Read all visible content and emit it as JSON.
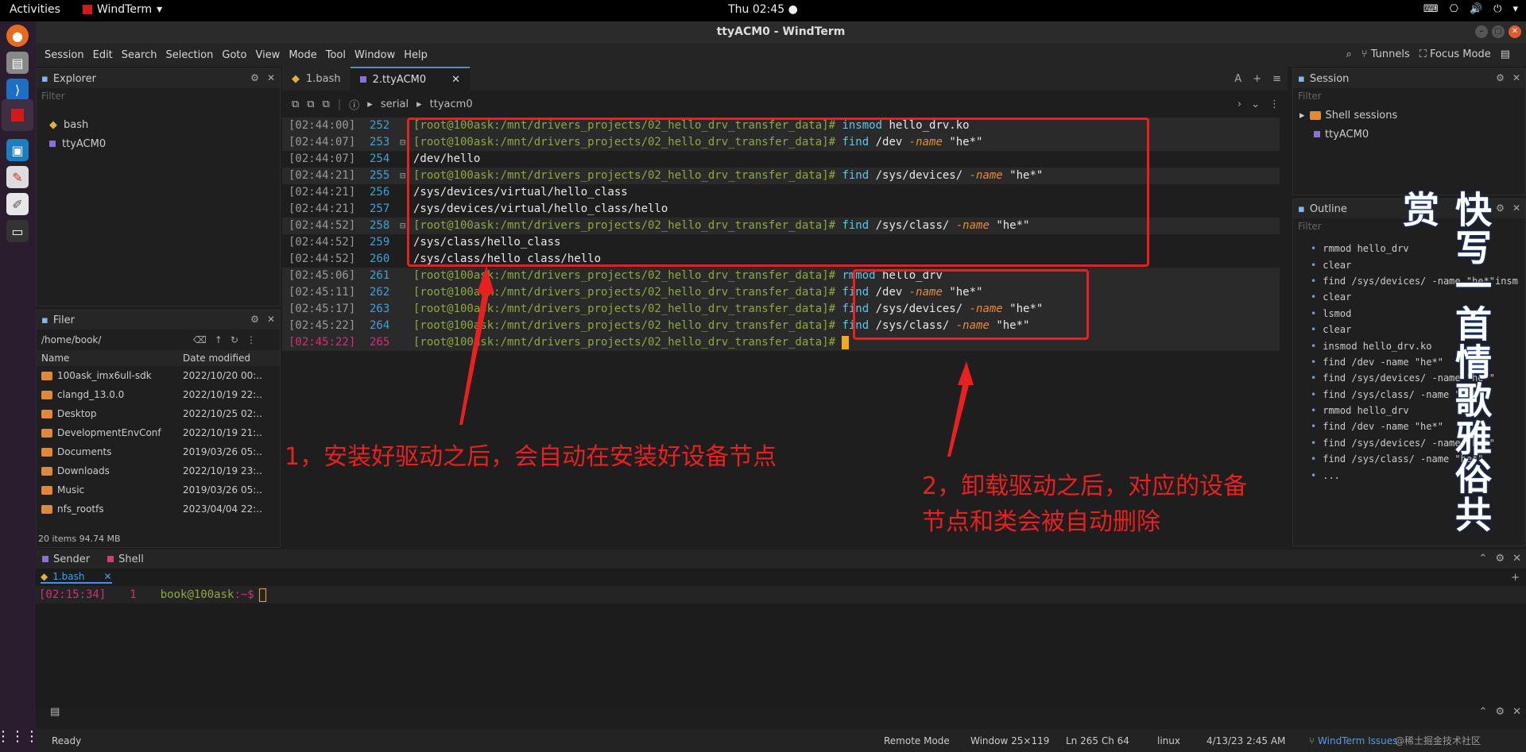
{
  "topbar": {
    "activities": "Activities",
    "app": "WindTerm",
    "clock": "Thu 02:45 ●"
  },
  "window": {
    "title": "ttyACM0 - WindTerm"
  },
  "menu": [
    "Session",
    "Edit",
    "Search",
    "Selection",
    "Goto",
    "View",
    "Mode",
    "Tool",
    "Window",
    "Help"
  ],
  "menu_right": {
    "tunnels": "Tunnels",
    "focus": "Focus Mode"
  },
  "explorer": {
    "title": "Explorer",
    "filter": "Filter",
    "items": [
      "bash",
      "ttyACM0"
    ]
  },
  "filer": {
    "title": "Filer",
    "path": "/home/book/",
    "col_name": "Name",
    "col_date": "Date modified",
    "rows": [
      [
        "100ask_imx6ull-sdk",
        "2022/10/20 00:.."
      ],
      [
        "clangd_13.0.0",
        "2022/10/19 22:.."
      ],
      [
        "Desktop",
        "2022/10/25 02:.."
      ],
      [
        "DevelopmentEnvConf",
        "2022/10/19 21:.."
      ],
      [
        "Documents",
        "2019/03/26 05:.."
      ],
      [
        "Downloads",
        "2022/10/19 23:.."
      ],
      [
        "Music",
        "2019/03/26 05:.."
      ],
      [
        "nfs_rootfs",
        "2023/04/04 22:.."
      ]
    ],
    "footer": "20 items 94.74 MB"
  },
  "tabs": [
    "1.bash",
    "2.ttyACM0"
  ],
  "crumb": [
    "serial",
    "ttyacm0"
  ],
  "prompt": "[root@100ask:/mnt/drivers_projects/02_hello_drv_transfer_data]# ",
  "lines": [
    {
      "ts": "[02:44:00]",
      "ln": "252",
      "cmd": "insmod",
      "rest": " hello_drv.ko"
    },
    {
      "ts": "[02:44:07]",
      "ln": "253",
      "cmd": "find",
      "rest": " /dev ",
      "opt": "-name",
      "str": " \"he*\""
    },
    {
      "ts": "[02:44:07]",
      "ln": "254",
      "out": "/dev/hello"
    },
    {
      "ts": "[02:44:21]",
      "ln": "255",
      "cmd": "find",
      "rest": " /sys/devices/ ",
      "opt": "-name",
      "str": " \"he*\""
    },
    {
      "ts": "[02:44:21]",
      "ln": "256",
      "out": "/sys/devices/virtual/hello_class"
    },
    {
      "ts": "[02:44:21]",
      "ln": "257",
      "out": "/sys/devices/virtual/hello_class/hello"
    },
    {
      "ts": "[02:44:52]",
      "ln": "258",
      "cmd": "find",
      "rest": " /sys/class/ ",
      "opt": "-name",
      "str": " \"he*\""
    },
    {
      "ts": "[02:44:52]",
      "ln": "259",
      "out": "/sys/class/hello_class"
    },
    {
      "ts": "[02:44:52]",
      "ln": "260",
      "out": "/sys/class/hello_class/hello"
    },
    {
      "ts": "[02:45:06]",
      "ln": "261",
      "cmd": "rmmod",
      "rest": " hello_drv"
    },
    {
      "ts": "[02:45:11]",
      "ln": "262",
      "cmd": "find",
      "rest": " /dev ",
      "opt": "-name",
      "str": " \"he*\""
    },
    {
      "ts": "[02:45:17]",
      "ln": "263",
      "cmd": "find",
      "rest": " /sys/devices/ ",
      "opt": "-name",
      "str": " \"he*\""
    },
    {
      "ts": "[02:45:22]",
      "ln": "264",
      "cmd": "find",
      "rest": " /sys/class/ ",
      "opt": "-name",
      "str": " \"he*\""
    },
    {
      "ts": "[02:45:22]",
      "ln": "265",
      "cursor": true
    }
  ],
  "annotations": {
    "a1": "1，安装好驱动之后，会自动在安装好设备节点",
    "a2_l1": "2，卸载驱动之后，对应的设备",
    "a2_l2": "节点和类会被自动删除",
    "vertical": "快写一首情歌雅俗共赏"
  },
  "session": {
    "title": "Session",
    "filter": "Filter",
    "group": "Shell sessions",
    "item": "ttyACM0"
  },
  "outline": {
    "title": "Outline",
    "filter": "Filter",
    "items": [
      "rmmod hello_drv",
      "clear",
      "find /sys/devices/ -name \"he*\"insm",
      "clear",
      "lsmod",
      "clear",
      "insmod hello_drv.ko",
      "find /dev -name \"he*\"",
      "find /sys/devices/ -name \"he*\"",
      "find /sys/class/ -name \"he*\"",
      "rmmod hello_drv",
      "find /dev -name \"he*\"",
      "find /sys/devices/ -name \"he*\"",
      "find /sys/class/ -name \"he*\"",
      "..."
    ]
  },
  "bottom": {
    "tab_sender": "Sender",
    "tab_shell": "Shell",
    "subtab": "1.bash",
    "ts": "[02:15:34]",
    "ln": "1",
    "prompt": "book@100ask",
    "tail": ":~$"
  },
  "status": {
    "ready": "Ready",
    "mode": "Remote Mode",
    "window": "Window 25×119",
    "pos": "Ln 265 Ch 64",
    "os": "linux",
    "time": "4/13/23 2:45 AM",
    "issues": "WindTerm Issues",
    "watermark": "@稀土掘金技术社区"
  }
}
